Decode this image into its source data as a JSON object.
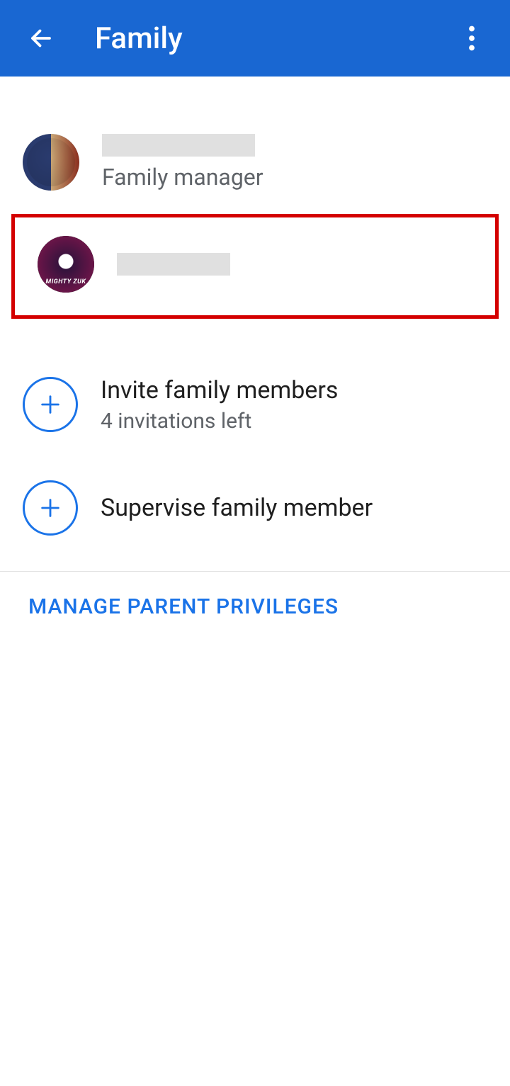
{
  "header": {
    "title": "Family"
  },
  "members": [
    {
      "name_redacted": true,
      "role": "Family manager",
      "avatar": "captain-iron"
    },
    {
      "name_redacted": true,
      "role": "",
      "avatar": "mighty-zuk",
      "avatar_label": "MIGHTY ZUK",
      "highlighted": true
    }
  ],
  "actions": [
    {
      "title": "Invite family members",
      "subtitle": "4 invitations left"
    },
    {
      "title": "Supervise family member",
      "subtitle": ""
    }
  ],
  "footer": {
    "manage_privileges_label": "MANAGE PARENT PRIVILEGES"
  }
}
